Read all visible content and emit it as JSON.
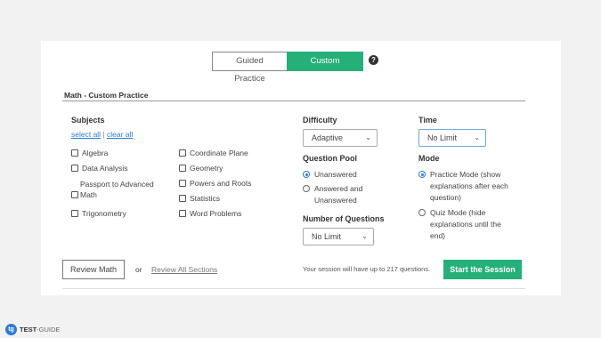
{
  "toggle": {
    "guided": "Guided Practice",
    "custom": "Custom Practice",
    "help": "?"
  },
  "section_title": "Math - Custom Practice",
  "subjects": {
    "heading": "Subjects",
    "select_all": "select all",
    "separator": " | ",
    "clear_all": "clear all",
    "items": [
      "Algebra",
      "Data Analysis",
      "Passport to Advanced Math",
      "Trigonometry",
      "Coordinate Plane",
      "Geometry",
      "Powers and Roots",
      "Statistics",
      "Word Problems"
    ]
  },
  "difficulty": {
    "heading": "Difficulty",
    "value": "Adaptive"
  },
  "question_pool": {
    "heading": "Question Pool",
    "options": [
      "Unanswered",
      "Answered and Unanswered"
    ],
    "selected": "Unanswered"
  },
  "number_of_questions": {
    "heading": "Number of Questions",
    "value": "No Limit"
  },
  "time": {
    "heading": "Time",
    "value": "No Limit"
  },
  "mode": {
    "heading": "Mode",
    "options": [
      "Practice Mode (show explanations after each question)",
      "Quiz Mode (hide explanations until the end)"
    ],
    "selected": "Practice Mode (show explanations after each question)"
  },
  "footer": {
    "review_button": "Review Math",
    "or": "or",
    "review_all": "Review All Sections",
    "session_note": "Your session will have up to 217 questions.",
    "start_button": "Start the Session"
  },
  "brand": {
    "part1": "TEST",
    "part2": "-GUIDE",
    "mark": "tg"
  },
  "colors": {
    "accent_green": "#25b07a",
    "link_blue": "#2a7bd6"
  }
}
